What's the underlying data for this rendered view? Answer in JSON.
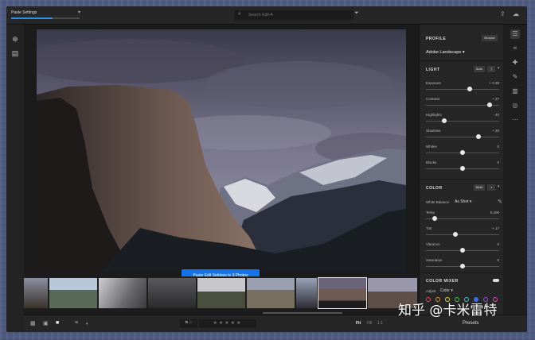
{
  "topbar": {
    "progress_label": "Paste Settings",
    "progress_fraction": 0.6,
    "search_placeholder": "Search Edit-A",
    "icons": [
      "chevron-down-icon",
      "search-icon",
      "filter-icon",
      "share-icon",
      "cloud-icon"
    ]
  },
  "toast": "Paste Edit Settings to 9 Photos",
  "panel": {
    "profile": {
      "title": "PROFILE",
      "browse_label": "Browse",
      "selected": "Adobe Landscape"
    },
    "light": {
      "title": "LIGHT",
      "auto_label": "Auto",
      "sliders": [
        {
          "label": "Exposure",
          "value": "+ 0.38",
          "position": 0.6
        },
        {
          "label": "Contrast",
          "value": "+ 37",
          "position": 0.87
        },
        {
          "label": "Highlights",
          "value": "- 40",
          "position": 0.25
        },
        {
          "label": "Shadows",
          "value": "+ 30",
          "position": 0.72
        },
        {
          "label": "Whites",
          "value": "0",
          "position": 0.5
        },
        {
          "label": "Blacks",
          "value": "0",
          "position": 0.5
        }
      ]
    },
    "color": {
      "title": "COLOR",
      "bw_label": "B&W",
      "white_balance_label": "White Balance",
      "white_balance_value": "As Shot",
      "sliders": [
        {
          "label": "Temp",
          "value": "5,200",
          "position": 0.12
        },
        {
          "label": "Tint",
          "value": "+ 17",
          "position": 0.4
        },
        {
          "label": "Vibrance",
          "value": "0",
          "position": 0.5
        },
        {
          "label": "Saturation",
          "value": "0",
          "position": 0.5
        }
      ]
    },
    "color_mixer": {
      "title": "COLOR MIXER",
      "adjust_label": "Adjust",
      "adjust_value": "Color",
      "dots": [
        "#e04848",
        "#e08a2e",
        "#e0d43a",
        "#4cc04c",
        "#3fc0c8",
        "#3a6ee8",
        "#a04ae0",
        "#e04ab8"
      ]
    }
  },
  "bottombar": {
    "zoom_fit": "Fit",
    "zoom_fill": "Fill",
    "zoom_1to1": "1:1",
    "presets_label": "Presets",
    "stars": "★★★★★",
    "flags": "⚑⚐"
  },
  "watermark": "知乎 @卡米雷特",
  "colors": {
    "accent": "#1473e6",
    "panel_bg": "#262626",
    "app_bg": "#1f1f1f"
  }
}
